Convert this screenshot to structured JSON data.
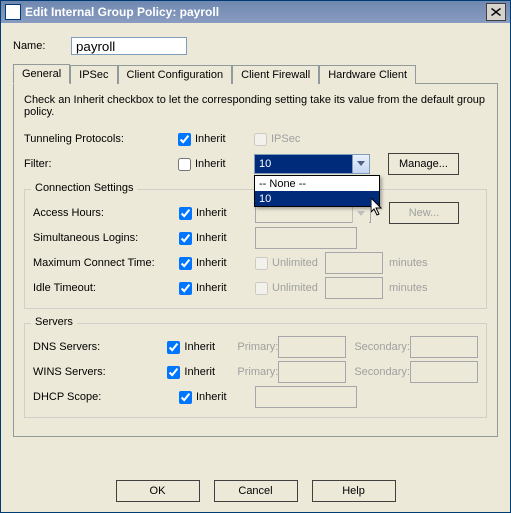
{
  "window": {
    "title": "Edit Internal Group Policy: payroll"
  },
  "name": {
    "label": "Name:",
    "value": "payroll"
  },
  "tabs": [
    "General",
    "IPSec",
    "Client Configuration",
    "Client Firewall",
    "Hardware Client"
  ],
  "panel": {
    "desc": "Check an Inherit checkbox to let the corresponding setting take its value from the default group policy.",
    "inherit": "Inherit",
    "tunneling": {
      "label": "Tunneling Protocols:",
      "ipsec": "IPSec"
    },
    "filter": {
      "label": "Filter:",
      "value": "10",
      "options": [
        "-- None --",
        "10"
      ],
      "manage": "Manage..."
    },
    "conn": {
      "title": "Connection Settings",
      "access": {
        "label": "Access Hours:",
        "new": "New..."
      },
      "logins": {
        "label": "Simultaneous Logins:"
      },
      "maxconn": {
        "label": "Maximum Connect Time:",
        "unlimited": "Unlimited",
        "unit": "minutes"
      },
      "idle": {
        "label": "Idle Timeout:",
        "unlimited": "Unlimited",
        "unit": "minutes"
      }
    },
    "servers": {
      "title": "Servers",
      "dns": {
        "label": "DNS Servers:",
        "primary": "Primary:",
        "secondary": "Secondary:"
      },
      "wins": {
        "label": "WINS Servers:",
        "primary": "Primary:",
        "secondary": "Secondary:"
      },
      "dhcp": {
        "label": "DHCP Scope:"
      }
    }
  },
  "footer": {
    "ok": "OK",
    "cancel": "Cancel",
    "help": "Help"
  }
}
